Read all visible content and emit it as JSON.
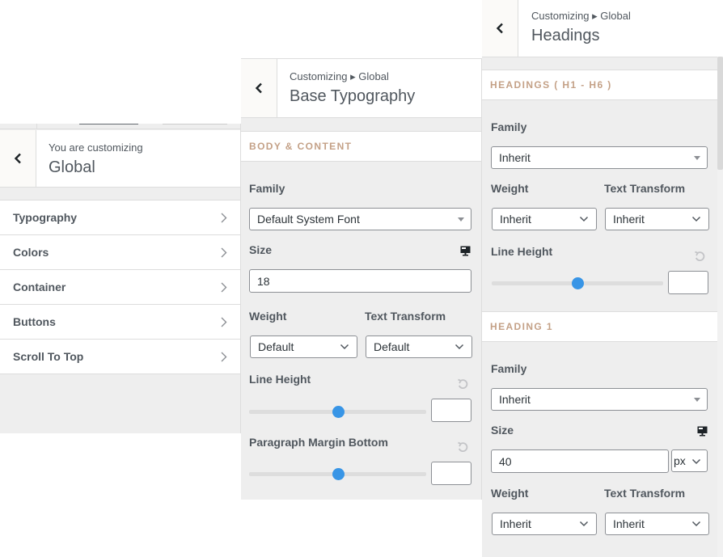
{
  "global_panel": {
    "header_sub": "You are customizing",
    "header_title": "Global",
    "items": [
      {
        "label": "Typography"
      },
      {
        "label": "Colors"
      },
      {
        "label": "Container"
      },
      {
        "label": "Buttons"
      },
      {
        "label": "Scroll To Top"
      }
    ]
  },
  "base_panel": {
    "breadcrumb": "Customizing ▸ Global",
    "title": "Base Typography",
    "group_title": "BODY & CONTENT",
    "family_label": "Family",
    "family_value": "Default System Font",
    "size_label": "Size",
    "size_value": "18",
    "weight_label": "Weight",
    "weight_value": "Default",
    "transform_label": "Text Transform",
    "transform_value": "Default",
    "line_height_label": "Line Height",
    "line_height_slider": 0.5,
    "line_height_value": "",
    "para_margin_label": "Paragraph Margin Bottom",
    "para_margin_slider": 0.5,
    "para_margin_value": ""
  },
  "headings_panel": {
    "breadcrumb": "Customizing ▸ Global",
    "title": "Headings",
    "group_all": {
      "title": "HEADINGS ( H1 - H6 )",
      "family_label": "Family",
      "family_value": "Inherit",
      "weight_label": "Weight",
      "weight_value": "Inherit",
      "transform_label": "Text Transform",
      "transform_value": "Inherit",
      "line_height_label": "Line Height",
      "line_height_slider": 0.5,
      "line_height_value": ""
    },
    "group_h1": {
      "title": "HEADING 1",
      "family_label": "Family",
      "family_value": "Inherit",
      "size_label": "Size",
      "size_value": "40",
      "size_unit": "px",
      "weight_label": "Weight",
      "weight_value": "Inherit",
      "transform_label": "Text Transform",
      "transform_value": "Inherit"
    }
  },
  "colors": {
    "accent": "#3895e6",
    "group_title": "#c4a187",
    "panel_bg": "#eeeeee"
  }
}
